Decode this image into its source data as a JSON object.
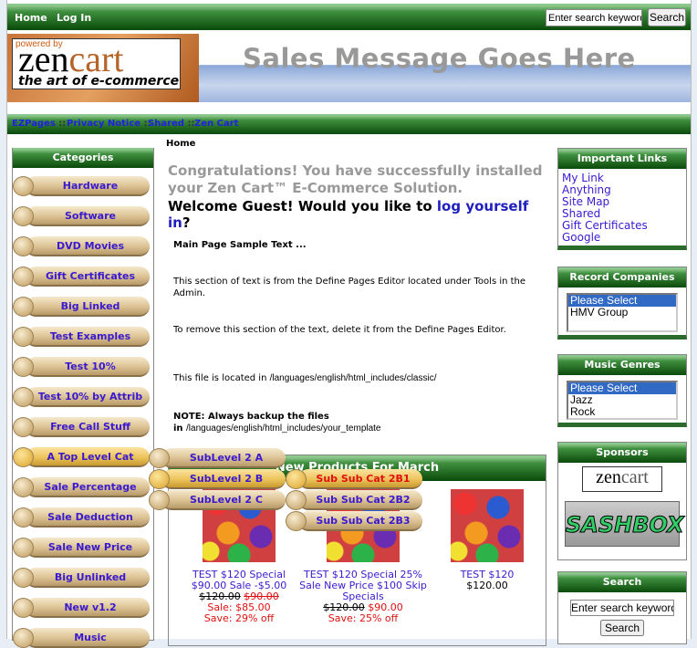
{
  "header": {
    "nav": [
      "Home",
      "Log In"
    ],
    "search_placeholder": "Enter search keywords",
    "search_button": "Search"
  },
  "banner": {
    "logo_powered": "powered by",
    "logo_zen": "zen",
    "logo_cart": "cart",
    "logo_tagline": "the art of e-commerce",
    "sales_message": "Sales Message Goes Here"
  },
  "ezpages": {
    "links": [
      "EZPages",
      "Privacy Notice",
      "Shared",
      "Zen Cart"
    ],
    "separator": "::"
  },
  "breadcrumb": "Home",
  "categories": {
    "title": "Categories",
    "items": [
      "Hardware",
      "Software",
      "DVD Movies",
      "Gift Certificates",
      "Big Linked",
      "Test Examples",
      "Test 10%",
      "Test 10% by Attrib",
      "Free Call Stuff",
      "A Top Level Cat",
      "Sale Percentage",
      "Sale Deduction",
      "Sale New Price",
      "Big Unlinked",
      "New v1.2",
      "Music"
    ],
    "active": "A Top Level Cat"
  },
  "flyout": {
    "level2": [
      "SubLevel 2 A",
      "SubLevel 2 B",
      "SubLevel 2 C"
    ],
    "level3": [
      "Sub Sub Cat 2B1",
      "Sub Sub Cat 2B2",
      "Sub Sub Cat 2B3"
    ],
    "highlight_color": "#e01010"
  },
  "main": {
    "congrats": "Congratulations! You have successfully installed your Zen Cart™ E-Commerce Solution.",
    "welcome_prefix": "Welcome Guest! Would you like to ",
    "welcome_link": "log yourself in",
    "welcome_suffix": "?",
    "sample_title": "Main Page Sample Text ...",
    "p1": "This section of text is from the Define Pages Editor located under Tools in the Admin.",
    "p2": "To remove this section of the text, delete it from the Define Pages Editor.",
    "p3_prefix": "This file is located in ",
    "p3_path": "/languages/english/html_includes/classic/",
    "note_title": "NOTE: Always backup the files",
    "note_prefix": "in ",
    "note_path": "/languages/english/html_includes/your_template"
  },
  "new_products": {
    "title": "New Products For March",
    "items": [
      {
        "name": "TEST $120 Special $90.00 Sale -$5.00",
        "old": "$120.00",
        "special": "$90.00",
        "sale": "Sale: $85.00",
        "save": "Save: 29% off"
      },
      {
        "name": "TEST $120 Special 25% Sale New Price $100 Skip Specials",
        "old": "$120.00",
        "special": "$90.00",
        "save": "Save: 25% off"
      },
      {
        "name": "TEST $120",
        "price": "$120.00"
      }
    ]
  },
  "sidebar": {
    "important_links": {
      "title": "Important Links",
      "items": [
        "My Link",
        "Anything",
        "Site Map",
        "Shared",
        "Gift Certificates",
        "Google"
      ]
    },
    "record_companies": {
      "title": "Record Companies",
      "options": [
        "Please Select",
        "HMV Group"
      ],
      "selected": "Please Select"
    },
    "music_genres": {
      "title": "Music Genres",
      "options": [
        "Please Select",
        "Jazz",
        "Rock"
      ],
      "selected": "Please Select"
    },
    "sponsors": {
      "title": "Sponsors",
      "logos": [
        "zen cart the art of e-commerce",
        "SASHBOX"
      ]
    },
    "search": {
      "title": "Search",
      "placeholder": "Enter search keywords",
      "button": "Search"
    }
  }
}
